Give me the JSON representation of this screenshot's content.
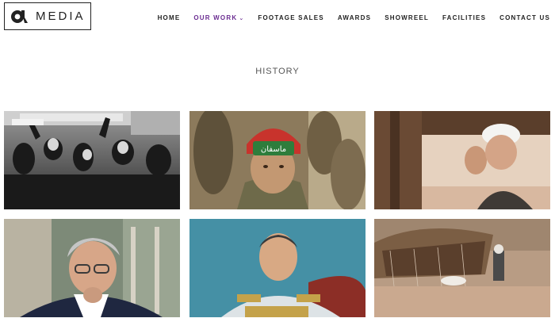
{
  "brand": {
    "logo_text": "MEDIA"
  },
  "nav": {
    "items": [
      {
        "label": "HOME",
        "active": false
      },
      {
        "label": "OUR WORK",
        "active": true,
        "has_dropdown": true
      },
      {
        "label": "FOOTAGE SALES",
        "active": false
      },
      {
        "label": "AWARDS",
        "active": false
      },
      {
        "label": "SHOWREEL",
        "active": false
      },
      {
        "label": "FACILITIES",
        "active": false
      },
      {
        "label": "CONTACT US",
        "active": false
      }
    ]
  },
  "page": {
    "section_title": "HISTORY"
  },
  "colors": {
    "accent": "#6a2c91",
    "text": "#222222",
    "muted": "#555555"
  },
  "gallery": {
    "tiles": [
      {
        "subject": "black-and-white crowd protest photo"
      },
      {
        "subject": "child soldier in red helmet with headband",
        "headband_text": "ماسفان"
      },
      {
        "subject": "cleric in white turban at window"
      },
      {
        "subject": "man in suit with glasses, hand on chin"
      },
      {
        "subject": "portrait of Shah in military uniform"
      },
      {
        "subject": "tent in rocky desert landscape"
      }
    ]
  }
}
